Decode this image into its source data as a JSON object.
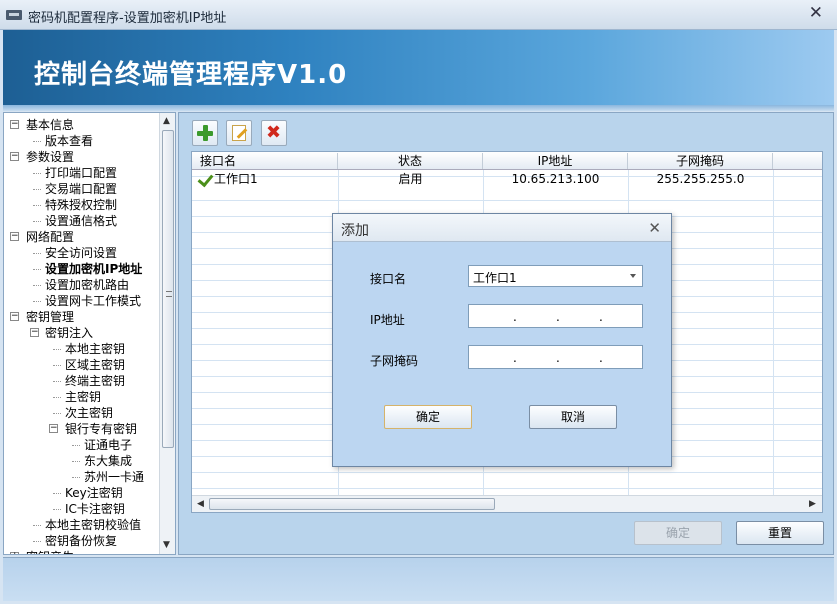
{
  "window": {
    "title": "密码机配置程序-设置加密机IP地址",
    "close_glyph": "✕"
  },
  "banner": {
    "heading": "控制台终端管理程序V1.0"
  },
  "tree": {
    "nodes": [
      {
        "label": "基本信息",
        "level": 0,
        "toggle": "−"
      },
      {
        "label": "版本查看",
        "level": 1
      },
      {
        "label": "参数设置",
        "level": 0,
        "toggle": "−"
      },
      {
        "label": "打印端口配置",
        "level": 1
      },
      {
        "label": "交易端口配置",
        "level": 1
      },
      {
        "label": "特殊授权控制",
        "level": 1
      },
      {
        "label": "设置通信格式",
        "level": 1
      },
      {
        "label": "网络配置",
        "level": 0,
        "toggle": "−"
      },
      {
        "label": "安全访问设置",
        "level": 1
      },
      {
        "label": "设置加密机IP地址",
        "level": 1,
        "selected": true
      },
      {
        "label": "设置加密机路由",
        "level": 1
      },
      {
        "label": "设置网卡工作模式",
        "level": 1
      },
      {
        "label": "密钥管理",
        "level": 0,
        "toggle": "−"
      },
      {
        "label": "密钥注入",
        "level": 1,
        "toggle": "−"
      },
      {
        "label": "本地主密钥",
        "level": 2
      },
      {
        "label": "区域主密钥",
        "level": 2
      },
      {
        "label": "终端主密钥",
        "level": 2
      },
      {
        "label": "主密钥",
        "level": 2
      },
      {
        "label": "次主密钥",
        "level": 2
      },
      {
        "label": "银行专有密钥",
        "level": 2,
        "toggle": "−"
      },
      {
        "label": "证通电子",
        "level": 3
      },
      {
        "label": "东大集成",
        "level": 3
      },
      {
        "label": "苏州一卡通",
        "level": 3
      },
      {
        "label": "Key注密钥",
        "level": 2
      },
      {
        "label": "IC卡注密钥",
        "level": 2
      },
      {
        "label": "本地主密钥校验值",
        "level": 1
      },
      {
        "label": "密钥备份恢复",
        "level": 1
      },
      {
        "label": "密钥产生",
        "level": 0,
        "toggle": "+"
      }
    ]
  },
  "table": {
    "columns": [
      "接口名",
      "状态",
      "IP地址",
      "子网掩码"
    ],
    "rows": [
      {
        "name": "工作口1",
        "status": "启用",
        "ip": "10.65.213.100",
        "mask": "255.255.255.0"
      }
    ]
  },
  "footer": {
    "confirm_label": "确定",
    "reset_label": "重置"
  },
  "dialog": {
    "title": "添加",
    "close_glyph": "✕",
    "interface_label": "接口名",
    "interface_value": "工作口1",
    "ip_label": "IP地址",
    "mask_label": "子网掩码",
    "confirm_label": "确定",
    "cancel_label": "取消"
  },
  "colors": {
    "accent": "#2f82c0",
    "panel": "#b9d4ec",
    "dialog": "#bcd6f1",
    "check": "#4b8f1a",
    "delete": "#d0281c",
    "add": "#3c9a2c"
  }
}
